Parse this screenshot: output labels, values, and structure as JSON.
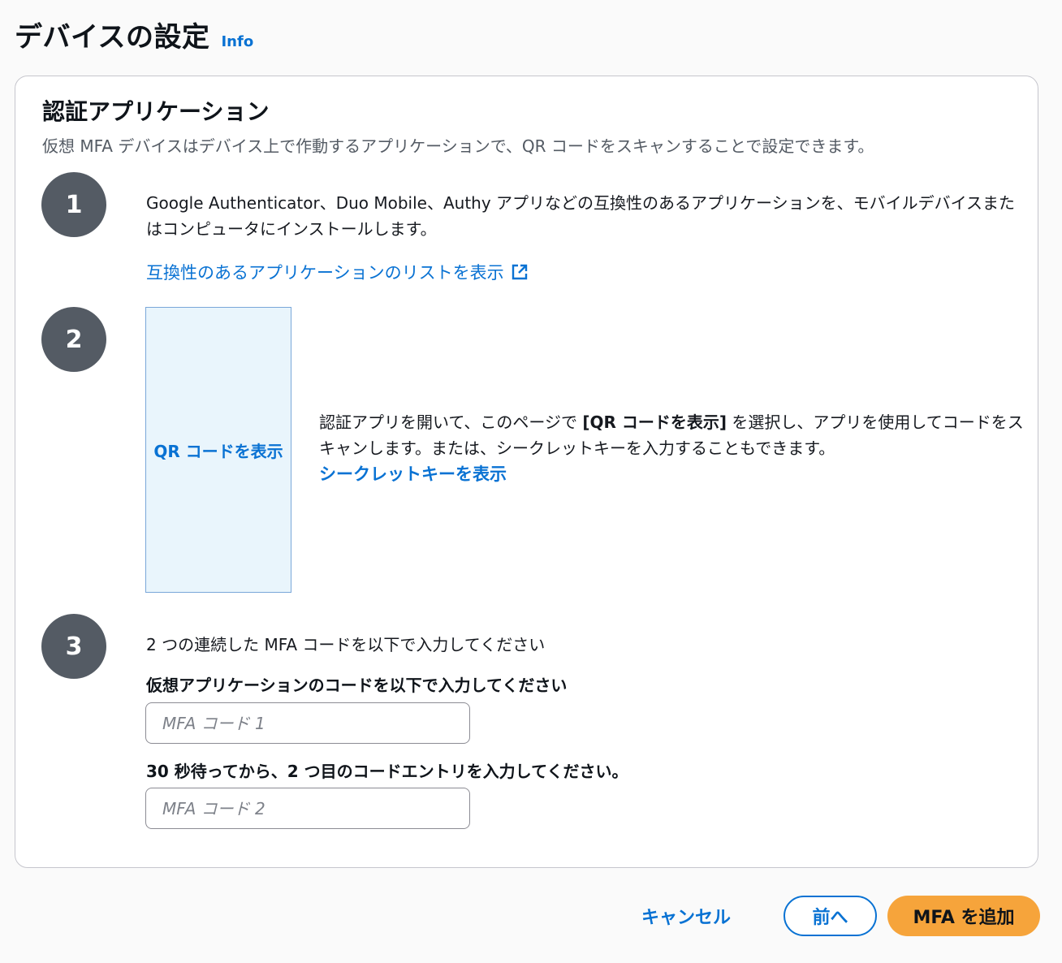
{
  "header": {
    "title": "デバイスの設定",
    "info_link": "Info"
  },
  "card": {
    "title": "認証アプリケーション",
    "description": "仮想 MFA デバイスはデバイス上で作動するアプリケーションで、QR コードをスキャンすることで設定できます。"
  },
  "steps": [
    {
      "number": "1",
      "text": "Google Authenticator、Duo Mobile、Authy アプリなどの互換性のあるアプリケーションを、モバイルデバイスまたはコンピュータにインストールします。",
      "link": "互換性のあるアプリケーションのリストを表示",
      "link_icon": "external-link-icon"
    },
    {
      "number": "2",
      "qr_button": "QR コードを表示",
      "text_before": "認証アプリを開いて、このページで ",
      "text_bold": "[QR コードを表示]",
      "text_after": " を選択し、アプリを使用してコードをスキャンします。または、シークレットキーを入力することもできます。",
      "secret_link": "シークレットキーを表示"
    },
    {
      "number": "3",
      "intro": "2 つの連続した MFA コードを以下で入力してください",
      "field1_label": "仮想アプリケーションのコードを以下で入力してください",
      "field1_placeholder": "MFA コード 1",
      "field1_value": "",
      "field2_label": "30 秒待ってから、2 つ目のコードエントリを入力してください。",
      "field2_placeholder": "MFA コード 2",
      "field2_value": ""
    }
  ],
  "footer": {
    "cancel": "キャンセル",
    "back": "前へ",
    "submit": "MFA を追加"
  },
  "colors": {
    "link": "#0972d3",
    "step_circle": "#545b64",
    "primary_button": "#f6a43b",
    "qr_box_bg": "#e9f5fc"
  }
}
